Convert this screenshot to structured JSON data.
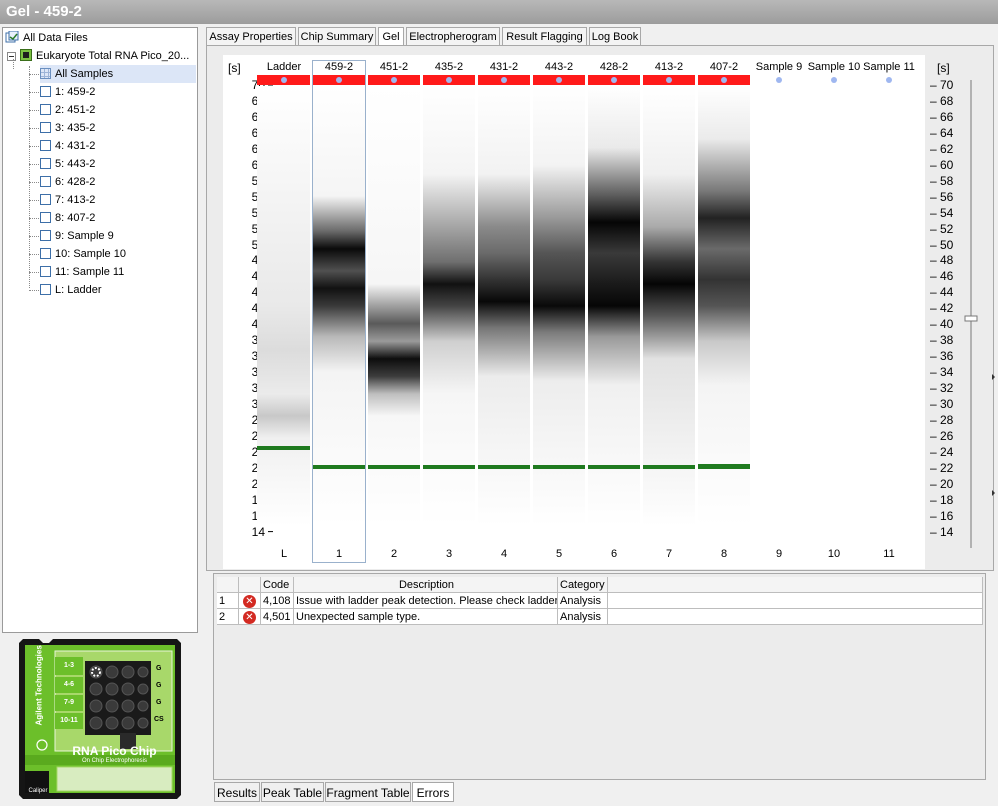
{
  "window": {
    "title": "Gel - 459-2"
  },
  "tree": {
    "root": "All Data Files",
    "file": "Eukaryote Total RNA Pico_20...",
    "items": [
      "All Samples",
      "1: 459-2",
      "2: 451-2",
      "3: 435-2",
      "4: 431-2",
      "5: 443-2",
      "6: 428-2",
      "7: 413-2",
      "8: 407-2",
      "9: Sample 9",
      "10: Sample 10",
      "11: Sample 11",
      "L: Ladder"
    ]
  },
  "tabs": [
    "Assay Properties",
    "Chip Summary",
    "Gel",
    "Electropherogram",
    "Result Flagging",
    "Log Book"
  ],
  "gel": {
    "unit_label": "[s]",
    "lanes": [
      "Ladder",
      "459-2",
      "451-2",
      "435-2",
      "431-2",
      "443-2",
      "428-2",
      "413-2",
      "407-2",
      "Sample 9",
      "Sample 10",
      "Sample 11"
    ],
    "lane_numbers": [
      "L",
      "1",
      "2",
      "3",
      "4",
      "5",
      "6",
      "7",
      "8",
      "9",
      "10",
      "11"
    ],
    "ticks": [
      "70",
      "68",
      "66",
      "64",
      "62",
      "60",
      "58",
      "56",
      "54",
      "52",
      "50",
      "48",
      "46",
      "44",
      "42",
      "40",
      "38",
      "36",
      "34",
      "32",
      "30",
      "28",
      "26",
      "24",
      "22",
      "20",
      "18",
      "16",
      "14"
    ]
  },
  "errors": {
    "columns": [
      "Code",
      "Description",
      "Category"
    ],
    "rows": [
      {
        "num": "1",
        "code": "4,108",
        "description": "Issue with ladder peak detection. Please check ladder.",
        "category": "Analysis"
      },
      {
        "num": "2",
        "code": "4,501",
        "description": "Unexpected sample type.",
        "category": "Analysis"
      }
    ]
  },
  "bottom_tabs": [
    "Results",
    "Peak Table",
    "Fragment Table",
    "Errors"
  ],
  "chip": {
    "brand": "Agilent Technologies",
    "name": "RNA Pico Chip",
    "subtitle": "On Chip Electrophoresis",
    "row_labels": [
      "1-3",
      "4-6",
      "7-9",
      "10-11"
    ],
    "right_labels": [
      "G",
      "G",
      "G",
      "CS"
    ],
    "maker": "Caliper"
  },
  "colors": {
    "accent_red": "#ff1a1a",
    "marker_green": "#1f7a1f",
    "title_bg": "#a4a4a4",
    "chip_green": "#6cbf2a"
  }
}
